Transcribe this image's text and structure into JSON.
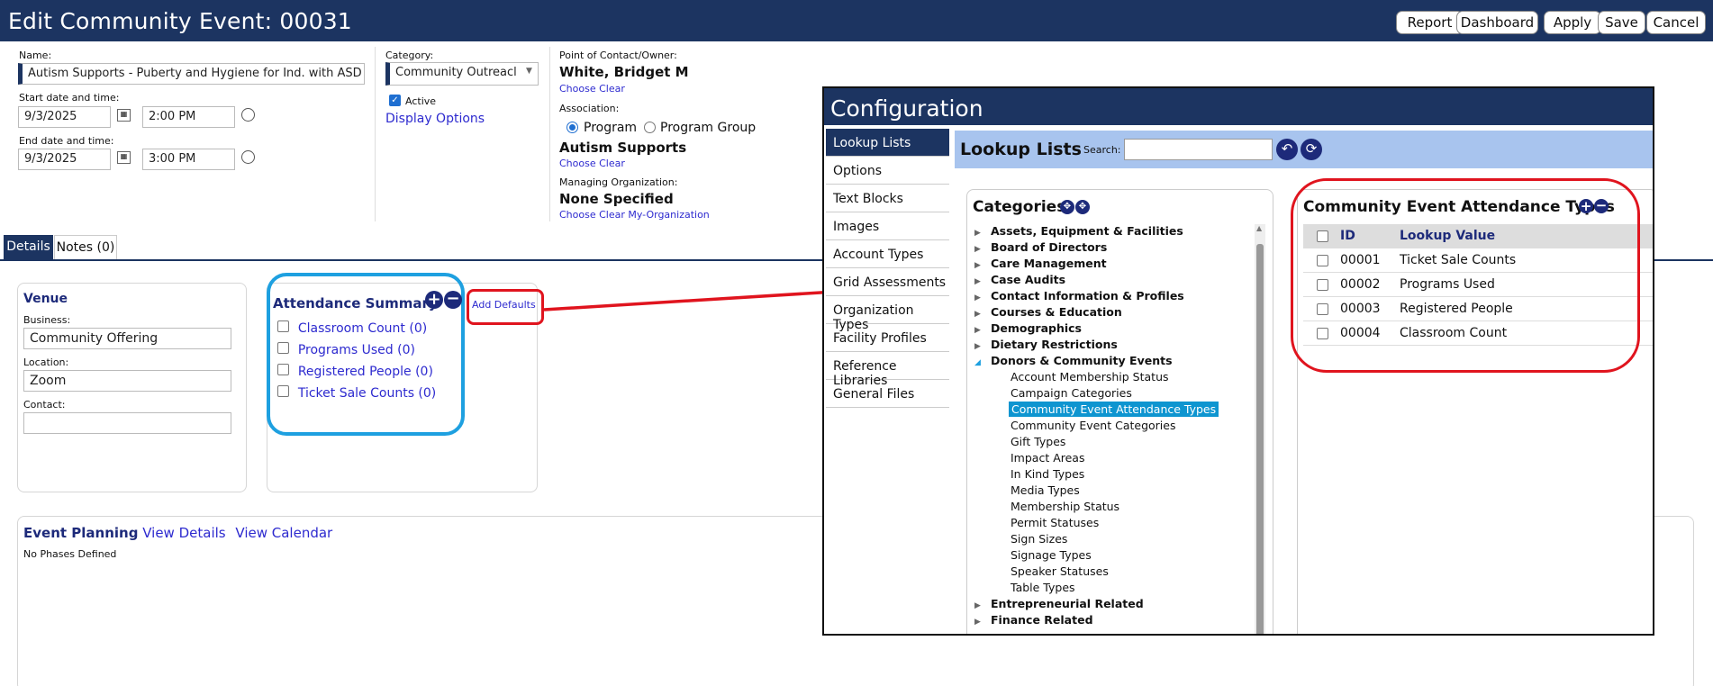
{
  "header": {
    "title": "Edit Community Event: 00031",
    "buttons": [
      "Report",
      "Dashboard",
      "Apply",
      "Save",
      "Cancel"
    ]
  },
  "form": {
    "name_label": "Name:",
    "name_value": "Autism Supports - Puberty and Hygiene for Ind. with ASD",
    "start_label": "Start date and time:",
    "start_date": "9/3/2025",
    "start_time": "2:00 PM",
    "end_label": "End date and time:",
    "end_date": "9/3/2025",
    "end_time": "3:00 PM",
    "category_label": "Category:",
    "category_value": "Community Outreacl",
    "active_label": "Active",
    "display_options": "Display Options",
    "poc_label": "Point of Contact/Owner:",
    "poc_value": "White, Bridget M",
    "poc_links": "Choose Clear",
    "assoc_label": "Association:",
    "assoc_program": "Program",
    "assoc_group": "Program Group",
    "assoc_value": "Autism Supports",
    "assoc_links": "Choose Clear",
    "managing_label": "Managing Organization:",
    "managing_value": "None Specified",
    "managing_links": "Choose Clear My-Organization"
  },
  "tabs": [
    "Details",
    "Notes (0)"
  ],
  "venue": {
    "title": "Venue",
    "business_label": "Business:",
    "business_value": "Community Offering",
    "location_label": "Location:",
    "location_value": "Zoom",
    "contact_label": "Contact:",
    "contact_value": ""
  },
  "attendance": {
    "title": "Attendance Summary",
    "add_defaults": "Add Defaults",
    "items": [
      "Classroom Count (0)",
      "Programs Used (0)",
      "Registered People (0)",
      "Ticket Sale Counts (0)"
    ]
  },
  "planning": {
    "title": "Event Planning",
    "view_details": "View Details",
    "view_calendar": "View Calendar",
    "empty": "No Phases Defined"
  },
  "config": {
    "title": "Configuration",
    "menu": [
      "Lookup Lists",
      "Options",
      "Text Blocks",
      "Images",
      "Account Types",
      "Grid Assessments",
      "Organization Types",
      "Facility Profiles",
      "Reference Libraries",
      "General Files"
    ],
    "lookup_title": "Lookup Lists",
    "search_label": "Search:",
    "categories_title": "Categories",
    "tree_top": [
      "Assets, Equipment & Facilities",
      "Board of Directors",
      "Care Management",
      "Case Audits",
      "Contact Information & Profiles",
      "Courses & Education",
      "Demographics",
      "Dietary Restrictions"
    ],
    "tree_open": "Donors & Community Events",
    "tree_children": [
      "Account Membership Status",
      "Campaign Categories",
      "Community Event Attendance Types",
      "Community Event Categories",
      "Gift Types",
      "Impact Areas",
      "In Kind Types",
      "Media Types",
      "Membership Status",
      "Permit Statuses",
      "Sign Sizes",
      "Signage Types",
      "Speaker Statuses",
      "Table Types"
    ],
    "tree_after": [
      "Entrepreneurial Related",
      "Finance Related"
    ],
    "list_title": "Community Event Attendance Types",
    "col_id": "ID",
    "col_value": "Lookup Value",
    "rows": [
      {
        "id": "00001",
        "value": "Ticket Sale Counts"
      },
      {
        "id": "00002",
        "value": "Programs Used"
      },
      {
        "id": "00003",
        "value": "Registered People"
      },
      {
        "id": "00004",
        "value": "Classroom Count"
      }
    ]
  },
  "colors": {
    "navy": "#1c3461",
    "highlight_blue": "#1ea0e0",
    "annotation_red": "#e0141e",
    "selected_item": "#0e95d0"
  }
}
